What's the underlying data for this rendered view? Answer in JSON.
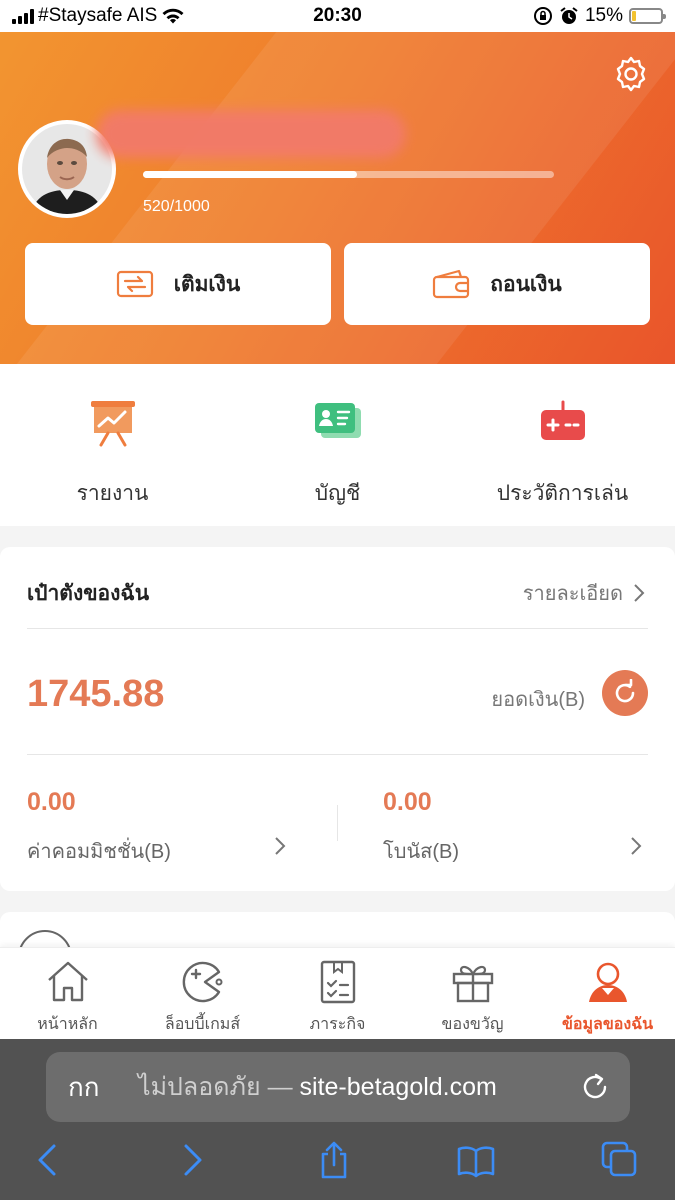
{
  "status_bar": {
    "carrier": "#Staysafe AIS",
    "time": "20:30",
    "battery_percent": "15%",
    "battery_level": 0.15,
    "battery_color": "#f2c230"
  },
  "header": {
    "progress_text": "520/1000",
    "progress_value": 520,
    "progress_max": 1000,
    "deposit_label": "เติมเงิน",
    "withdraw_label": "ถอนเงิน",
    "settings_icon": "gear-icon",
    "colors": {
      "gradient_start": "#f29530",
      "gradient_end": "#e9552b"
    }
  },
  "quick_actions": [
    {
      "label": "รายงาน",
      "icon": "report-chart-icon",
      "color": "#ef7d3e"
    },
    {
      "label": "บัญชี",
      "icon": "account-card-icon",
      "color": "#3fbf7f"
    },
    {
      "label": "ประวัติการเล่น",
      "icon": "game-controller-icon",
      "color": "#e84b4b"
    }
  ],
  "wallet": {
    "title": "เป๋าตังของฉัน",
    "detail_link": "รายละเอียด",
    "balance": "1745.88",
    "balance_label": "ยอดเงิน(B)",
    "commission_value": "0.00",
    "commission_label": "ค่าคอมมิชชั่น(B)",
    "bonus_value": "0.00",
    "bonus_label": "โบนัส(B)",
    "accent": "#e47a55"
  },
  "tabbar": {
    "items": [
      {
        "label": "หน้าหลัก",
        "icon": "home-icon",
        "active": false
      },
      {
        "label": "ล็อบบี้เกมส์",
        "icon": "game-lobby-icon",
        "active": false
      },
      {
        "label": "ภาระกิจ",
        "icon": "task-clipboard-icon",
        "active": false
      },
      {
        "label": "ของขวัญ",
        "icon": "gift-icon",
        "active": false
      },
      {
        "label": "ข้อมูลของฉัน",
        "icon": "profile-icon",
        "active": true
      }
    ],
    "active_color": "#e9562d"
  },
  "browser": {
    "aa_label": "กก",
    "insecure_label": "ไม่ปลอดภัย —",
    "domain": "site-betagold.com"
  }
}
